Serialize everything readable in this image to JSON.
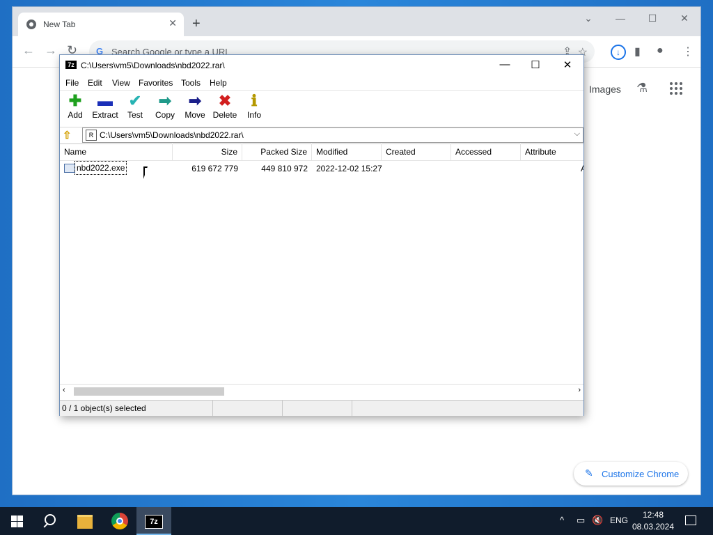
{
  "chrome": {
    "tab_title": "New Tab",
    "omnibox_placeholder": "Search Google or type a URL",
    "images_link": "Images",
    "customize_label": "Customize Chrome"
  },
  "sevenzip": {
    "title": "C:\\Users\\vm5\\Downloads\\nbd2022.rar\\",
    "menu": [
      "File",
      "Edit",
      "View",
      "Favorites",
      "Tools",
      "Help"
    ],
    "toolbar": [
      "Add",
      "Extract",
      "Test",
      "Copy",
      "Move",
      "Delete",
      "Info"
    ],
    "address": "C:\\Users\\vm5\\Downloads\\nbd2022.rar\\",
    "columns": [
      "Name",
      "Size",
      "Packed Size",
      "Modified",
      "Created",
      "Accessed",
      "Attribute"
    ],
    "rows": [
      {
        "name": "nbd2022.exe",
        "size": "619 672 779",
        "packed": "449 810 972",
        "modified": "2022-12-02 15:27",
        "created": "",
        "accessed": "",
        "attr": "A"
      }
    ],
    "status": "0 / 1 object(s) selected"
  },
  "taskbar": {
    "language": "ENG",
    "time": "12:48",
    "date": "08.03.2024"
  },
  "colors": {
    "desktop": "#1f6fc4",
    "taskbar": "#101c2c",
    "chrome_accent": "#1a73e8"
  }
}
